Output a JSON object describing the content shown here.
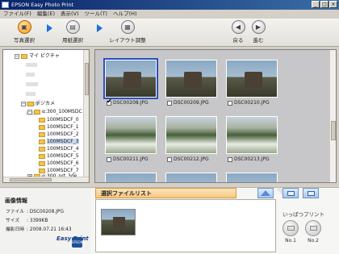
{
  "window": {
    "title": "EPSON Easy Photo Print",
    "controls": [
      "_",
      "□",
      "×"
    ]
  },
  "menu": [
    "ファイル(F)",
    "編集(E)",
    "表示(V)",
    "ツール(T)",
    "ヘルプ(H)"
  ],
  "toolbar": {
    "steps": [
      {
        "label": "写真選択",
        "icon": "photo-select-icon"
      },
      {
        "label": "用紙選択",
        "icon": "paper-select-icon"
      },
      {
        "label": "レイアウト調整",
        "icon": "layout-adjust-icon"
      }
    ],
    "back_label": "戻る",
    "next_label": "進む"
  },
  "tree": {
    "root": "マイ ピクチャ",
    "digicam": "デジカメ",
    "camera_folder": "α:300_100MSDC",
    "subfolders": [
      "100MSDCF_0",
      "100MSDCF_1",
      "100MSDCF_2",
      "100MSDCF_3",
      "100MSDCF_4",
      "100MSDCF_5",
      "100MSDCF_6",
      "100MSDCF_7"
    ],
    "last_item": "α:300_prt_3de"
  },
  "photos": [
    {
      "name": "DSC00208.JPG",
      "checked": true
    },
    {
      "name": "DSC00209.JPG",
      "checked": false
    },
    {
      "name": "DSC00210.JPG",
      "checked": false
    },
    {
      "name": "DSC00211.JPG",
      "checked": false
    },
    {
      "name": "DSC00212.JPG",
      "checked": false
    },
    {
      "name": "DSC00213.JPG",
      "checked": false
    }
  ],
  "info": {
    "title": "画像情報",
    "rows": [
      {
        "key": "ファイル",
        "value": "DSC00208.JPG"
      },
      {
        "key": "サイズ",
        "value": "3399KB"
      },
      {
        "key": "撮影日時",
        "value": "2008.07.21 16:43"
      }
    ],
    "logo_text": "Easy Print"
  },
  "selected_list": {
    "title": "選択ファイルリスト"
  },
  "oneshot": {
    "title": "いっぱつプリント",
    "buttons": [
      "No.1",
      "No.2"
    ]
  }
}
